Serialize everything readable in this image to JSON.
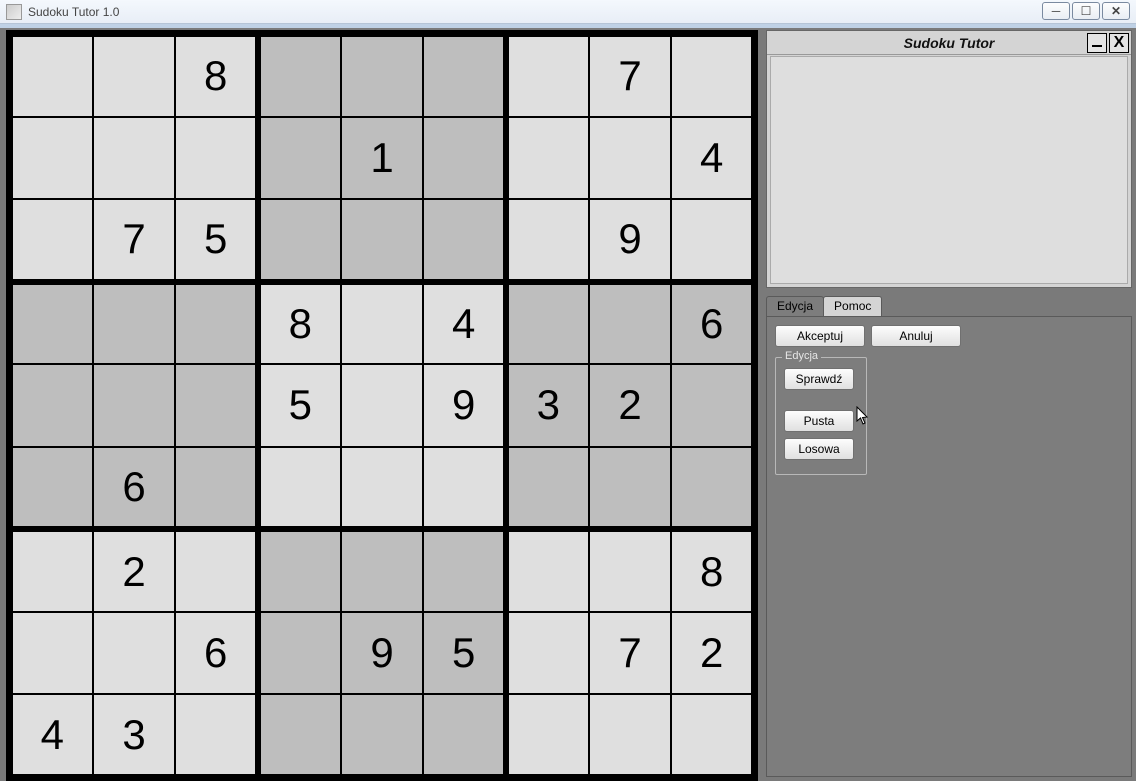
{
  "os_window": {
    "title": "Sudoku Tutor 1.0",
    "min_label": "_",
    "max_label": "▭",
    "close_label": "✕"
  },
  "tutor_window": {
    "title": "Sudoku Tutor",
    "close_label": "X"
  },
  "tabs": {
    "edit": "Edycja",
    "help": "Pomoc"
  },
  "buttons": {
    "accept": "Akceptuj",
    "cancel": "Anuluj",
    "check": "Sprawdź",
    "empty": "Pusta",
    "random": "Losowa"
  },
  "group_label": "Edycja",
  "grid": [
    [
      "",
      "",
      "8",
      "",
      "",
      "",
      "",
      "7",
      ""
    ],
    [
      "",
      "",
      "",
      "",
      "1",
      "",
      "",
      "",
      "4"
    ],
    [
      "",
      "7",
      "5",
      "",
      "",
      "",
      "",
      "9",
      ""
    ],
    [
      "",
      "",
      "",
      "8",
      "",
      "4",
      "",
      "",
      "6"
    ],
    [
      "",
      "",
      "",
      "5",
      "",
      "9",
      "3",
      "2",
      ""
    ],
    [
      "",
      "6",
      "",
      "",
      "",
      "",
      "",
      "",
      ""
    ],
    [
      "",
      "2",
      "",
      "",
      "",
      "",
      "",
      "",
      "8"
    ],
    [
      "",
      "",
      "6",
      "",
      "9",
      "5",
      "",
      "7",
      "2"
    ],
    [
      "4",
      "3",
      "",
      "",
      "",
      "",
      "",
      "",
      ""
    ]
  ]
}
